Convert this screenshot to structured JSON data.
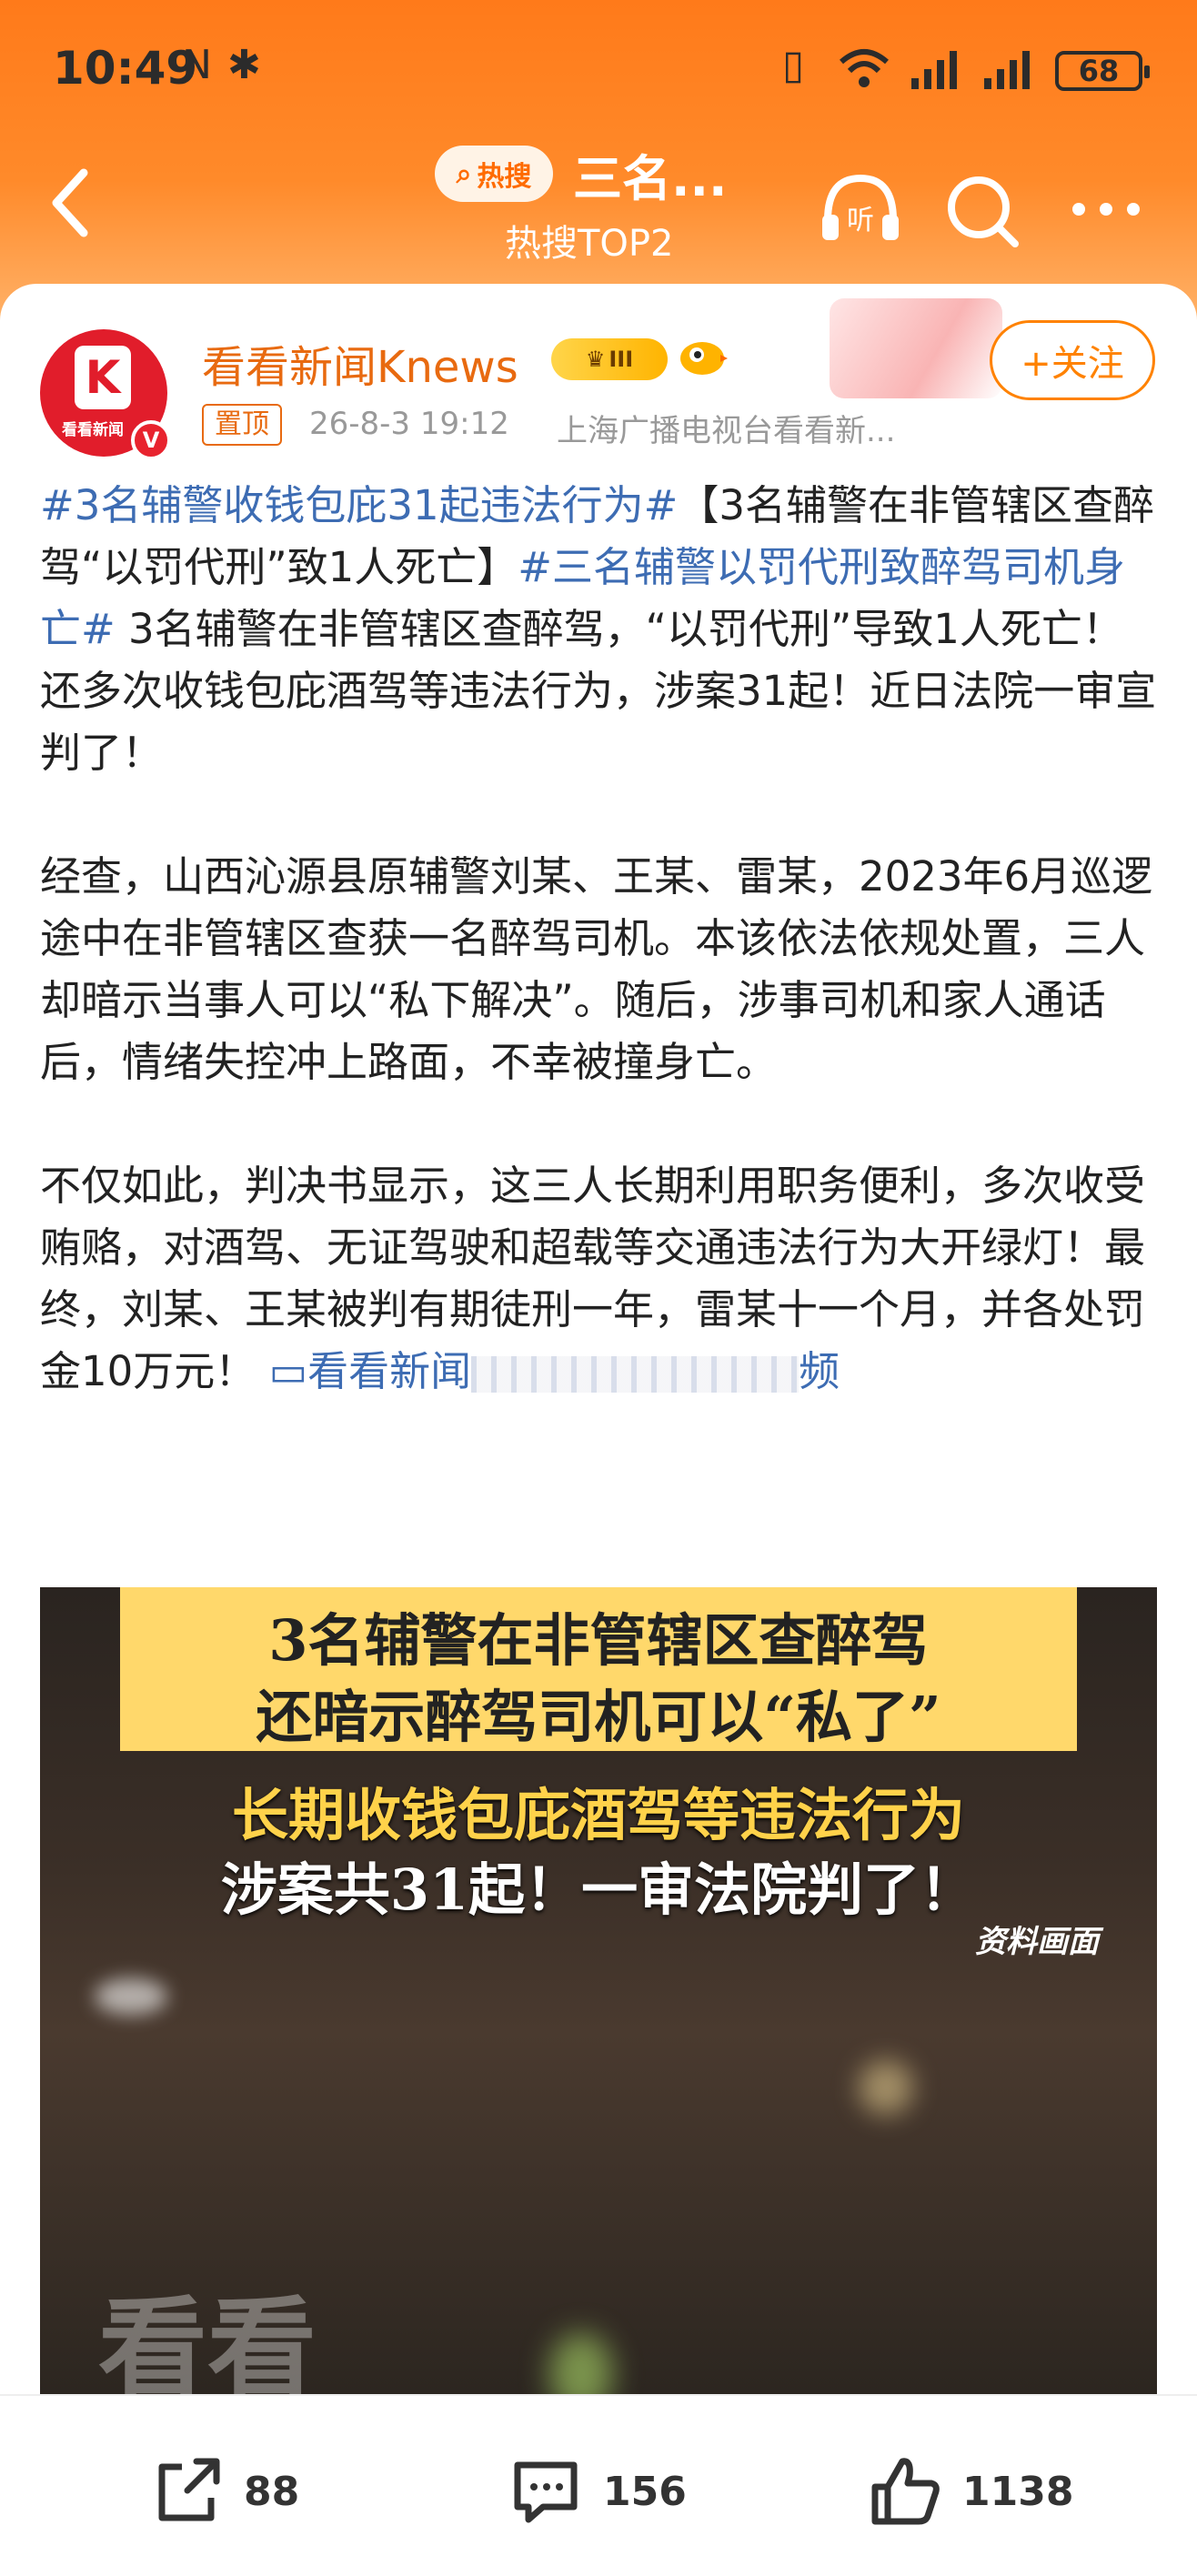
{
  "status_bar": {
    "time": "10:49",
    "battery": "68"
  },
  "nav": {
    "hot_badge": "热搜",
    "title": "三名...",
    "subtitle": "热搜TOP2"
  },
  "author": {
    "name": "看看新闻Knews",
    "avatar_text": "看看新闻",
    "level": "III",
    "follow_label": "+关注",
    "pin_label": "置顶",
    "time": "26-8-3 19:12",
    "source": "上海广播电视台看看新..."
  },
  "post": {
    "p1_tag1": "#3名辅警收钱包庇31起违法行为#",
    "p1_text1": "【3名辅警在非管辖区查醉驾“以罚代刑”致1人死亡】",
    "p1_tag2": "#三名辅警以罚代刑致醉驾司机身亡#",
    "p1_text2": " 3名辅警在非管辖区查醉驾，“以罚代刑”导致1人死亡！还多次收钱包庇酒驾等违法行为，涉案31起！近日法院一审宣判了！",
    "p2": "经查，山西沁源县原辅警刘某、王某、雷某，2023年6月巡逻途中在非管辖区查获一名醉驾司机。本该依法依规处置，三人却暗示当事人可以“私下解决”。随后，涉事司机和家人通话后，情绪失控冲上路面，不幸被撞身亡。",
    "p3": "不仅如此，判决书显示，这三人长期利用职务便利，多次收受贿赂，对酒驾、无证驾驶和超载等交通违法行为大开绿灯！最终，刘某、王某被判有期徒刑一年，雷某十一个月，并各处罚金10万元！",
    "video_link_start": "看看新",
    "video_link_end": "闻",
    "video_link_tail": "频"
  },
  "video": {
    "line1": "3名辅警在非管辖区查醉驾",
    "line2": "还暗示醉驾司机可以“私了”",
    "line3": "长期收钱包庇酒驾等违法行为",
    "line4": "涉案共31起！一审法院判了！",
    "caption": "资料画面",
    "watermark": "看看"
  },
  "actions": {
    "share_count": "88",
    "comment_count": "156",
    "like_count": "1138"
  },
  "colors": {
    "header_orange": "#ff7a1a",
    "author_orange": "#e86a10",
    "tag_blue": "#3d6cb3",
    "follow_orange": "#ff8200"
  }
}
